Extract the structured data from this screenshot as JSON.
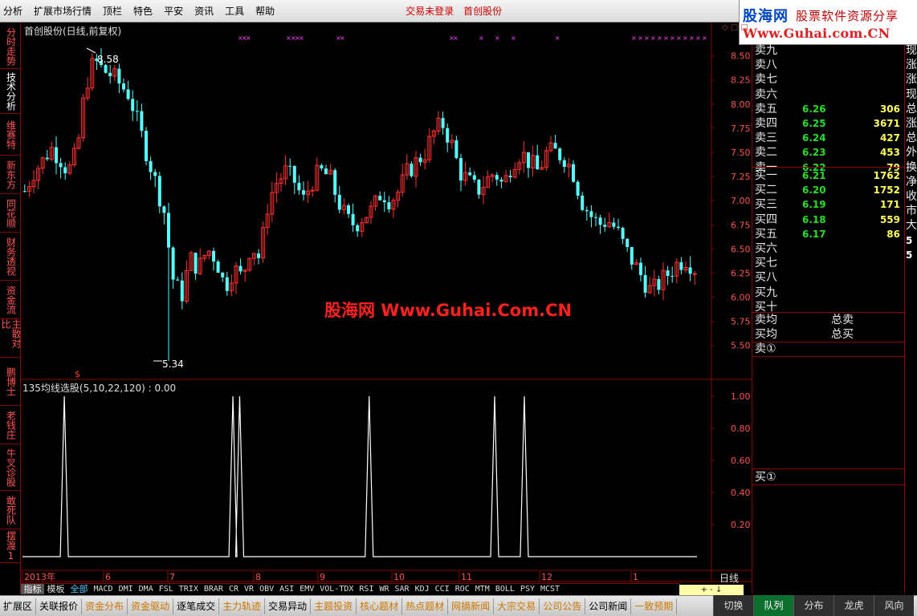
{
  "menubar": {
    "items": [
      "分析",
      "扩展市场行情",
      "顶栏",
      "特色",
      "平安",
      "资讯",
      "工具",
      "帮助"
    ],
    "trade_status": "交易未登录",
    "stock_name": "首创股份"
  },
  "brand": {
    "logo_text": "股海网",
    "slogan": "股票软件资源分享",
    "url": "Www.Guhai.com.CN"
  },
  "left_tabs": [
    {
      "label": "分时走势",
      "active": false
    },
    {
      "label": "技术分析",
      "active": true
    },
    {
      "label": "维赛特",
      "active": false
    },
    {
      "label": "新东方",
      "active": false
    },
    {
      "label": "同花顺",
      "active": false
    },
    {
      "label": "财务透视",
      "active": false
    },
    {
      "label": "资金流",
      "active": false
    },
    {
      "label": "主散对比",
      "active": false
    },
    {
      "label": "鹏博士",
      "active": false
    },
    {
      "label": "老钱庄",
      "active": false
    },
    {
      "label": "牛叉诊股",
      "active": false
    },
    {
      "label": "敢死队",
      "active": false
    },
    {
      "label": "摆渡1",
      "active": false
    }
  ],
  "chart": {
    "title": "首创股份(日线,前复权)",
    "high_label": "8.58",
    "low_label": "5.34",
    "watermark": "股海网 Www.Guhai.Com.CN",
    "indicator_title": "135均线选股(5,10,22,120) : 0.00",
    "period_label": "日线",
    "marker_symbol": "$",
    "corner_icons": "◇ □ □"
  },
  "chart_data": [
    {
      "type": "candlestick",
      "title": "首创股份(日线,前复权)",
      "ylim": [
        5.3,
        8.75
      ],
      "yticks": [
        "8.50",
        "8.25",
        "8.00",
        "7.75",
        "7.50",
        "7.25",
        "7.00",
        "6.75",
        "6.50",
        "6.25",
        "6.00",
        "5.75",
        "5.50"
      ],
      "xticks": [
        "2013年",
        "6",
        "7",
        "8",
        "9",
        "10",
        "11",
        "12",
        "1"
      ],
      "high": 8.58,
      "low": 5.34,
      "close_path": [
        7.1,
        7.3,
        7.4,
        7.55,
        7.45,
        7.3,
        7.5,
        8.2,
        8.45,
        8.35,
        8.3,
        8.2,
        8.1,
        7.8,
        7.5,
        7.2,
        6.9,
        6.2,
        6.0,
        6.4,
        6.3,
        6.5,
        6.4,
        6.1,
        6.3,
        6.2,
        6.55,
        6.4,
        7.0,
        7.2,
        7.3,
        7.2,
        7.0,
        7.2,
        7.3,
        7.25,
        7.0,
        6.8,
        6.75,
        6.85,
        6.9,
        7.1,
        7.0,
        7.1,
        7.3,
        7.4,
        7.5,
        7.7,
        7.8,
        7.6,
        7.3,
        7.2,
        7.1,
        7.2,
        7.3,
        7.15,
        7.4,
        7.5,
        7.4,
        7.3,
        7.5,
        7.5,
        7.45,
        7.3,
        7.0,
        6.85,
        6.75,
        6.8,
        6.7,
        6.5,
        6.35,
        6.2,
        6.05,
        6.15,
        6.25,
        6.35,
        6.4,
        6.3
      ]
    },
    {
      "type": "line",
      "title": "135均线选股(5,10,22,120) : 0.00",
      "ylim": [
        0,
        1.1
      ],
      "yticks": [
        "1.00",
        "0.80",
        "0.60",
        "0.40",
        "0.20"
      ],
      "signal_positions": [
        0.062,
        0.312,
        0.322,
        0.514,
        0.7,
        0.744
      ],
      "signal_value": 1.0,
      "baseline": 0.0
    }
  ],
  "order_book": {
    "sell": [
      {
        "label": "卖九",
        "price": "",
        "volume": ""
      },
      {
        "label": "卖八",
        "price": "",
        "volume": ""
      },
      {
        "label": "卖七",
        "price": "",
        "volume": ""
      },
      {
        "label": "卖六",
        "price": "",
        "volume": ""
      },
      {
        "label": "卖五",
        "price": "6.26",
        "volume": "306"
      },
      {
        "label": "卖四",
        "price": "6.25",
        "volume": "3671"
      },
      {
        "label": "卖三",
        "price": "6.24",
        "volume": "427"
      },
      {
        "label": "卖二",
        "price": "6.23",
        "volume": "453"
      },
      {
        "label": "卖一",
        "price": "6.22",
        "volume": "79"
      }
    ],
    "buy": [
      {
        "label": "买一",
        "price": "6.21",
        "volume": "1762"
      },
      {
        "label": "买二",
        "price": "6.20",
        "volume": "1752"
      },
      {
        "label": "买三",
        "price": "6.19",
        "volume": "171"
      },
      {
        "label": "买四",
        "price": "6.18",
        "volume": "559"
      },
      {
        "label": "买五",
        "price": "6.17",
        "volume": "86"
      },
      {
        "label": "买六",
        "price": "",
        "volume": ""
      },
      {
        "label": "买七",
        "price": "",
        "volume": ""
      },
      {
        "label": "买八",
        "price": "",
        "volume": ""
      },
      {
        "label": "买九",
        "price": "",
        "volume": ""
      },
      {
        "label": "买十",
        "price": "",
        "volume": ""
      }
    ],
    "sell_avg": "卖均",
    "buy_avg": "买均",
    "total_sell": "总卖",
    "total_buy": "总买",
    "sell_queue": "卖①",
    "buy_queue": "买①"
  },
  "far_right_chars": [
    "现",
    "涨",
    "涨",
    "现",
    "总",
    "涨",
    "总",
    "外",
    "换",
    "净",
    "收",
    "市",
    "大",
    "5",
    "5"
  ],
  "indicator_tabs": [
    "指标",
    "模板",
    "全部",
    "MACD",
    "DMI",
    "DMA",
    "FSL",
    "TRIX",
    "BRAR",
    "CR",
    "VR",
    "OBV",
    "ASI",
    "EMV",
    "VOL-TDX",
    "RSI",
    "WR",
    "SAR",
    "KDJ",
    "CCI",
    "ROC",
    "MTM",
    "BOLL",
    "PSY",
    "MCST"
  ],
  "zoom_controls": "+ - ↓",
  "status_bar": [
    {
      "label": "扩展区",
      "color": "black"
    },
    {
      "label": "关联报价",
      "color": "black"
    },
    {
      "label": "资金分布",
      "color": "orange"
    },
    {
      "label": "资金驱动",
      "color": "orange"
    },
    {
      "label": "逐笔成交",
      "color": "black"
    },
    {
      "label": "主力轨迹",
      "color": "orange"
    },
    {
      "label": "交易异动",
      "color": "black"
    },
    {
      "label": "主题投资",
      "color": "orange"
    },
    {
      "label": "核心题材",
      "color": "orange"
    },
    {
      "label": "热点题材",
      "color": "orange"
    },
    {
      "label": "网摘新闻",
      "color": "orange"
    },
    {
      "label": "大宗交易",
      "color": "orange"
    },
    {
      "label": "公司公告",
      "color": "orange"
    },
    {
      "label": "公司新闻",
      "color": "black"
    },
    {
      "label": "一致预期",
      "color": "orange"
    }
  ],
  "right_buttons": [
    {
      "label": "切换",
      "active": false
    },
    {
      "label": "队列",
      "active": true
    },
    {
      "label": "分布",
      "active": false
    },
    {
      "label": "龙虎",
      "active": false
    },
    {
      "label": "风向",
      "active": false
    }
  ],
  "colors": {
    "up_candle": "#ff3030",
    "down_candle": "#55ffff",
    "grid": "#8a0000",
    "signal_line": "#ffffff",
    "event_markers": "#ff44ff"
  }
}
